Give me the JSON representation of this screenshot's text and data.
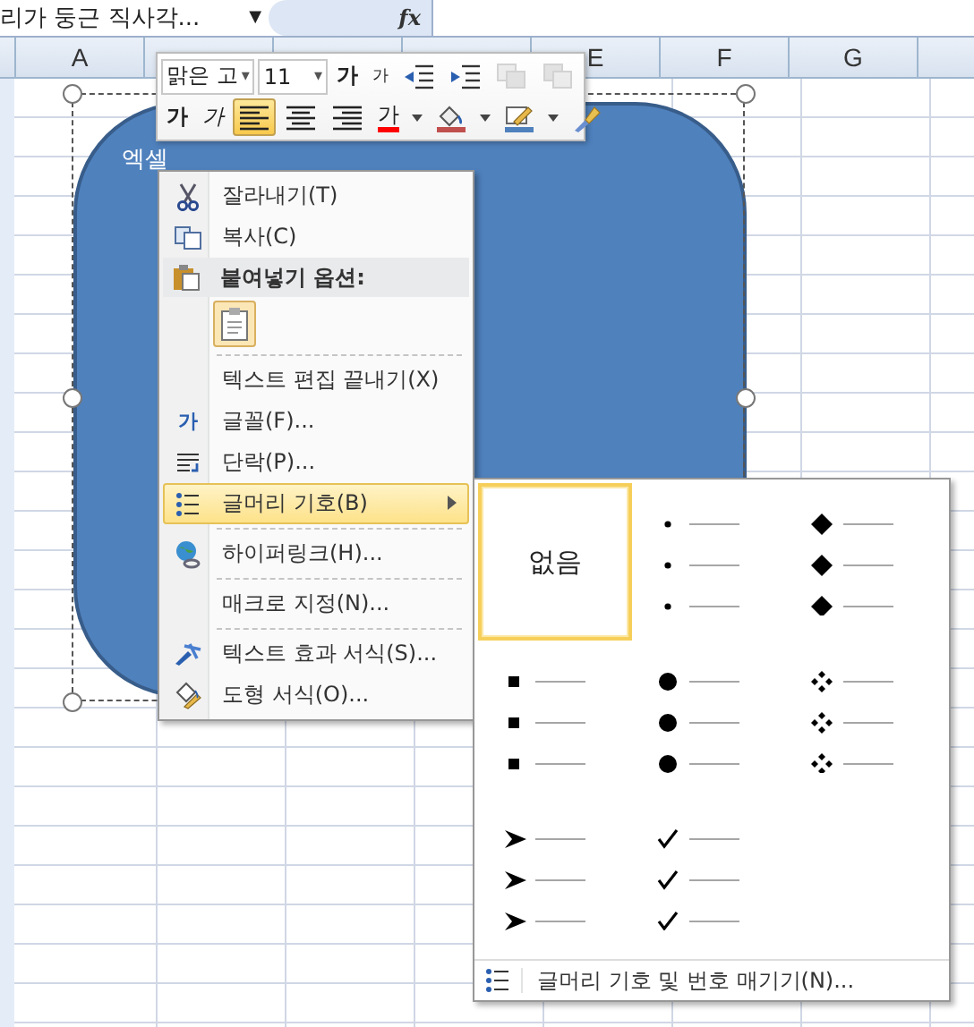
{
  "formula_bar": {
    "name_box": "리가 둥근 직사각...",
    "name_box_arrow": "▼",
    "fx_label": "fx"
  },
  "columns": [
    "A",
    "E",
    "F",
    "G"
  ],
  "shape": {
    "text": "엑셀",
    "selected": true
  },
  "mini_toolbar": {
    "font": "맑은 고",
    "font_arrow": "▾",
    "size": "11",
    "size_arrow": "▾",
    "row1": [
      {
        "kind": "grow",
        "glyph": "가",
        "disabled": false
      },
      {
        "kind": "shrink",
        "glyph": "가",
        "disabled": false
      },
      {
        "kind": "outdent",
        "disabled": false
      },
      {
        "kind": "indent",
        "disabled": false
      },
      {
        "kind": "front",
        "disabled": true
      },
      {
        "kind": "back",
        "disabled": true
      }
    ],
    "row2": [
      {
        "kind": "bold",
        "glyph": "가",
        "selected": false
      },
      {
        "kind": "italic",
        "glyph": "가",
        "selected": false
      },
      {
        "kind": "align-left",
        "selected": true
      },
      {
        "kind": "align-center",
        "selected": false
      },
      {
        "kind": "align-right",
        "selected": false
      },
      {
        "kind": "font-color",
        "glyph": "가",
        "color": "#ff0000",
        "dropdown": true,
        "selected": false
      },
      {
        "kind": "fill",
        "color": "#c0504d",
        "dropdown": true,
        "selected": false
      },
      {
        "kind": "line",
        "color": "#4f81bd",
        "dropdown": true,
        "selected": false
      },
      {
        "kind": "painter",
        "selected": false
      }
    ]
  },
  "context_menu": [
    {
      "kind": "cut",
      "label": "잘라내기(T)",
      "highlighted": false,
      "submenu": false,
      "separator": false
    },
    {
      "kind": "copy",
      "label": "복사(C)",
      "highlighted": false,
      "submenu": false,
      "separator": false
    },
    {
      "kind": "header",
      "label": "붙여넣기 옵션:"
    },
    {
      "kind": "paste-options"
    },
    {
      "kind": "plain",
      "label": "텍스트 편집 끝내기(X)",
      "highlighted": false,
      "submenu": false,
      "separator": true
    },
    {
      "kind": "glyph",
      "glyph": "가",
      "label": "글꼴(F)...",
      "highlighted": false,
      "submenu": false,
      "separator": false
    },
    {
      "kind": "paragraph",
      "label": "단락(P)...",
      "highlighted": false,
      "submenu": false,
      "separator": false
    },
    {
      "kind": "bullets",
      "label": "글머리 기호(B)",
      "highlighted": true,
      "submenu": true,
      "separator": false
    },
    {
      "kind": "globe",
      "label": "하이퍼링크(H)...",
      "highlighted": false,
      "submenu": false,
      "separator": true
    },
    {
      "kind": "plain",
      "label": "매크로 지정(N)...",
      "highlighted": false,
      "submenu": false,
      "separator": true
    },
    {
      "kind": "effects",
      "label": "텍스트 효과 서식(S)...",
      "highlighted": false,
      "submenu": false,
      "separator": true
    },
    {
      "kind": "shape-format",
      "label": "도형 서식(O)...",
      "highlighted": false,
      "submenu": false,
      "separator": false
    }
  ],
  "bullet_gallery": {
    "options": [
      {
        "kind": "none",
        "label": "없음",
        "selected": true
      },
      {
        "kind": "small-dot",
        "selected": false
      },
      {
        "kind": "diamond",
        "selected": false
      },
      {
        "kind": "square",
        "selected": false
      },
      {
        "kind": "dot",
        "selected": false
      },
      {
        "kind": "star",
        "selected": false
      },
      {
        "kind": "arrow",
        "selected": false
      },
      {
        "kind": "check",
        "selected": false
      }
    ],
    "footer": "글머리 기호 및 번호 매기기(N)..."
  }
}
